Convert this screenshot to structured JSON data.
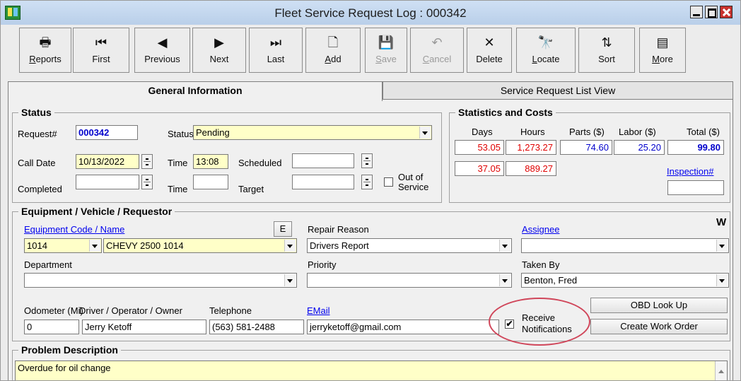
{
  "window": {
    "title": "Fleet Service Request Log : 000342"
  },
  "toolbar": [
    {
      "label": "Reports",
      "ul": "R",
      "icon": "printer-icon",
      "glyph": "🖶",
      "disabled": false
    },
    {
      "label": "First",
      "ul": "",
      "icon": "first-record-icon",
      "glyph": "⏮",
      "disabled": false
    },
    {
      "label": "Previous",
      "ul": "",
      "icon": "previous-icon",
      "glyph": "◀",
      "disabled": false
    },
    {
      "label": "Next",
      "ul": "",
      "icon": "next-icon",
      "glyph": "▶",
      "disabled": false
    },
    {
      "label": "Last",
      "ul": "",
      "icon": "last-record-icon",
      "glyph": "⏭",
      "disabled": false
    },
    {
      "label": "Add",
      "ul": "A",
      "icon": "new-document-icon",
      "glyph": "🗋",
      "disabled": false
    },
    {
      "label": "Save",
      "ul": "S",
      "icon": "save-icon",
      "glyph": "💾",
      "disabled": true
    },
    {
      "label": "Cancel",
      "ul": "C",
      "icon": "undo-icon",
      "glyph": "↶",
      "disabled": true
    },
    {
      "label": "Delete",
      "ul": "",
      "icon": "delete-icon",
      "glyph": "✕",
      "disabled": false
    },
    {
      "label": "Locate",
      "ul": "L",
      "icon": "binoculars-icon",
      "glyph": "🔭",
      "disabled": false
    },
    {
      "label": "Sort",
      "ul": "",
      "icon": "sort-az-icon",
      "glyph": "⇅",
      "disabled": false
    },
    {
      "label": "More",
      "ul": "M",
      "icon": "more-options-icon",
      "glyph": "▤",
      "disabled": false
    }
  ],
  "tabs": {
    "general": "General Information",
    "list": "Service Request List View"
  },
  "status": {
    "group_title": "Status",
    "request_label": "Request#",
    "request_value": "000342",
    "status_label": "Status",
    "status_value": "Pending",
    "call_date_label": "Call Date",
    "call_date_value": "10/13/2022",
    "time_label": "Time",
    "time_value": "13:08",
    "scheduled_label": "Scheduled",
    "completed_label": "Completed",
    "time2_label": "Time",
    "target_label": "Target",
    "out_of_service_label": "Out of Service",
    "out_of_service_line1": "Out of",
    "out_of_service_line2": "Service"
  },
  "stats": {
    "group_title": "Statistics and Costs",
    "headers": {
      "days": "Days",
      "hours": "Hours",
      "parts": "Parts ($)",
      "labor": "Labor ($)",
      "total": "Total ($)"
    },
    "row1": {
      "days": "53.05",
      "hours": "1,273.27",
      "parts": "74.60",
      "labor": "25.20",
      "total": "99.80"
    },
    "row2": {
      "days": "37.05",
      "hours": "889.27"
    },
    "inspection_label": "Inspection#",
    "colors": {
      "red": "#e00000",
      "blue": "#0000cc"
    }
  },
  "equipment": {
    "group_title": "Equipment / Vehicle / Requestor",
    "w_marker": "W",
    "equipment_label": "Equipment Code / Name",
    "e_button": "E",
    "code_value": "1014",
    "name_value": "CHEVY 2500 1014",
    "repair_reason_label": "Repair Reason",
    "repair_reason_value": "Drivers Report",
    "assignee_label": "Assignee",
    "department_label": "Department",
    "priority_label": "Priority",
    "taken_by_label": "Taken By",
    "taken_by_value": "Benton, Fred",
    "odometer_label": "Odometer (Mi)",
    "driver_label": "Driver / Operator / Owner",
    "telephone_label": "Telephone",
    "email_label": "EMail",
    "odometer_value": "0",
    "driver_value": "Jerry Ketoff",
    "telephone_value": "(563) 581-2488",
    "email_value": "jerryketoff@gmail.com",
    "receive_line1": "Receive",
    "receive_line2": "Notifications",
    "receive_checked": "✔",
    "obd_button": "OBD Look Up",
    "create_wo_button": "Create Work Order"
  },
  "problem": {
    "group_title": "Problem Description",
    "value": "Overdue for oil change"
  }
}
